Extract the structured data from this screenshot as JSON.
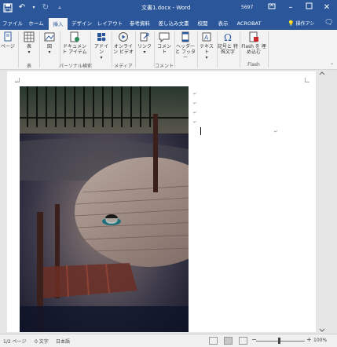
{
  "window": {
    "title": "文書1.docx - Word",
    "user_id": "5697"
  },
  "qat": {
    "save_icon": "save-icon",
    "undo_icon": "undo-icon",
    "redo_icon": "redo-icon",
    "more": "▾"
  },
  "tabs": [
    {
      "label": "ファイル"
    },
    {
      "label": "ホーム"
    },
    {
      "label": "挿入"
    },
    {
      "label": "デザイン"
    },
    {
      "label": "レイアウト"
    },
    {
      "label": "参考資料"
    },
    {
      "label": "差し込み文書"
    },
    {
      "label": "校閲"
    },
    {
      "label": "表示"
    },
    {
      "label": "ACROBAT"
    }
  ],
  "active_tab": "挿入",
  "tell_me": "操作アシ",
  "ribbon": {
    "buttons": {
      "pages": "ページ",
      "table": "表",
      "illustrations": "図",
      "document_item": "ドキュメン ト アイテム",
      "addins": "アドイン",
      "online_video": "オンライン ビデオ",
      "link": "リンク",
      "comment": "コメント",
      "header_footer": "ヘッダーと フッター",
      "text": "テキスト",
      "symbols": "記号と 特殊文字",
      "flash": "Flash を 埋め込む"
    },
    "groups": {
      "table": "表",
      "personal_search": "パーソナル検索",
      "media": "メディア",
      "comment": "コメント",
      "flash": "Flash"
    }
  },
  "status": {
    "page": "1/2 ページ",
    "words": "0 文字",
    "language": "日本語",
    "zoom": "100%",
    "zoom_minus": "−",
    "zoom_plus": "+"
  },
  "colors": {
    "accent": "#2b579a",
    "ribbon_bg": "#f3f3f3",
    "doc_bg": "#e6e6e6"
  }
}
